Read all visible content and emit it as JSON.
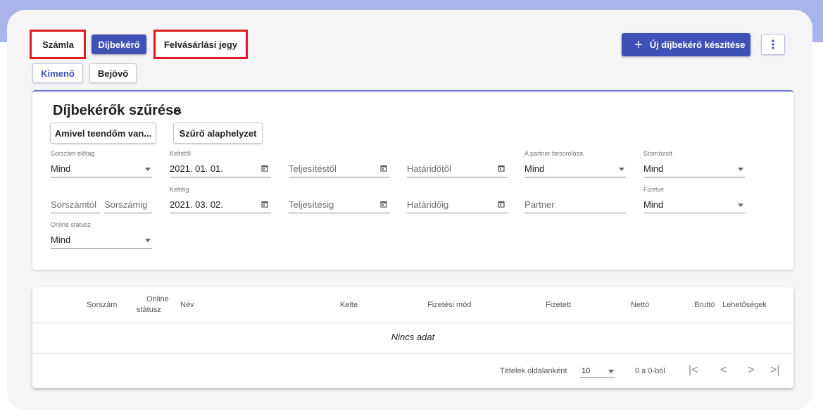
{
  "doc_tabs": {
    "szamla": "Számla",
    "dijbekero": "Díjbekérő",
    "felvasarlasi": "Felvásárlási jegy"
  },
  "direction_tabs": {
    "kimeno": "Kimenő",
    "bejovo": "Bejövő"
  },
  "actions": {
    "new_label": "Új díjbekérő készítése",
    "more_icon": "more-vertical-icon"
  },
  "filters": {
    "title": "Díjbekérők szűrése",
    "quick_button": "Amivel teendőm van...",
    "reset_button": "Szűrő alaphelyzet",
    "prefix": {
      "label": "Sorszám előtag",
      "value": "Mind"
    },
    "date_from": {
      "label": "Keltétől",
      "value": "2021. 01. 01."
    },
    "date_to": {
      "label": "Keltéig",
      "value": "2021. 03. 02."
    },
    "fulfil_from": {
      "placeholder": "Teljesítéstől"
    },
    "fulfil_to": {
      "placeholder": "Teljesítésig"
    },
    "due_from": {
      "placeholder": "Határidőtől"
    },
    "due_to": {
      "placeholder": "Határidőig"
    },
    "partner_class": {
      "label": "A partner besorolása",
      "value": "Mind"
    },
    "partner": {
      "placeholder": "Partner"
    },
    "cancelled": {
      "label": "Stornózott",
      "value": "Mind"
    },
    "paid": {
      "label": "Fizetve",
      "value": "Mind"
    },
    "serial_from": {
      "placeholder": "Sorszámtól"
    },
    "serial_to": {
      "placeholder": "Sorszámig"
    },
    "online_status": {
      "label": "Online státusz",
      "value": "Mind"
    }
  },
  "table": {
    "columns": {
      "sorszam": "Sorszám",
      "online_1": "Online",
      "online_2": "státusz",
      "nev": "Név",
      "kelte": "Kelte",
      "fizetesi_mod": "Fizetési mód",
      "fizetett": "Fizetett",
      "netto": "Nettó",
      "brutto": "Bruttó",
      "lehetosegek": "Lehetőségek"
    },
    "empty_text": "Nincs adat"
  },
  "pagination": {
    "per_page_label": "Tételek oldalanként",
    "per_page_value": "10",
    "range": "0 a 0-ból",
    "first": "|<",
    "prev": "<",
    "next": ">",
    "last": ">|"
  },
  "colors": {
    "primary": "#3f51b5",
    "highlight": "#e01b24",
    "band": "#a9b4ea"
  }
}
